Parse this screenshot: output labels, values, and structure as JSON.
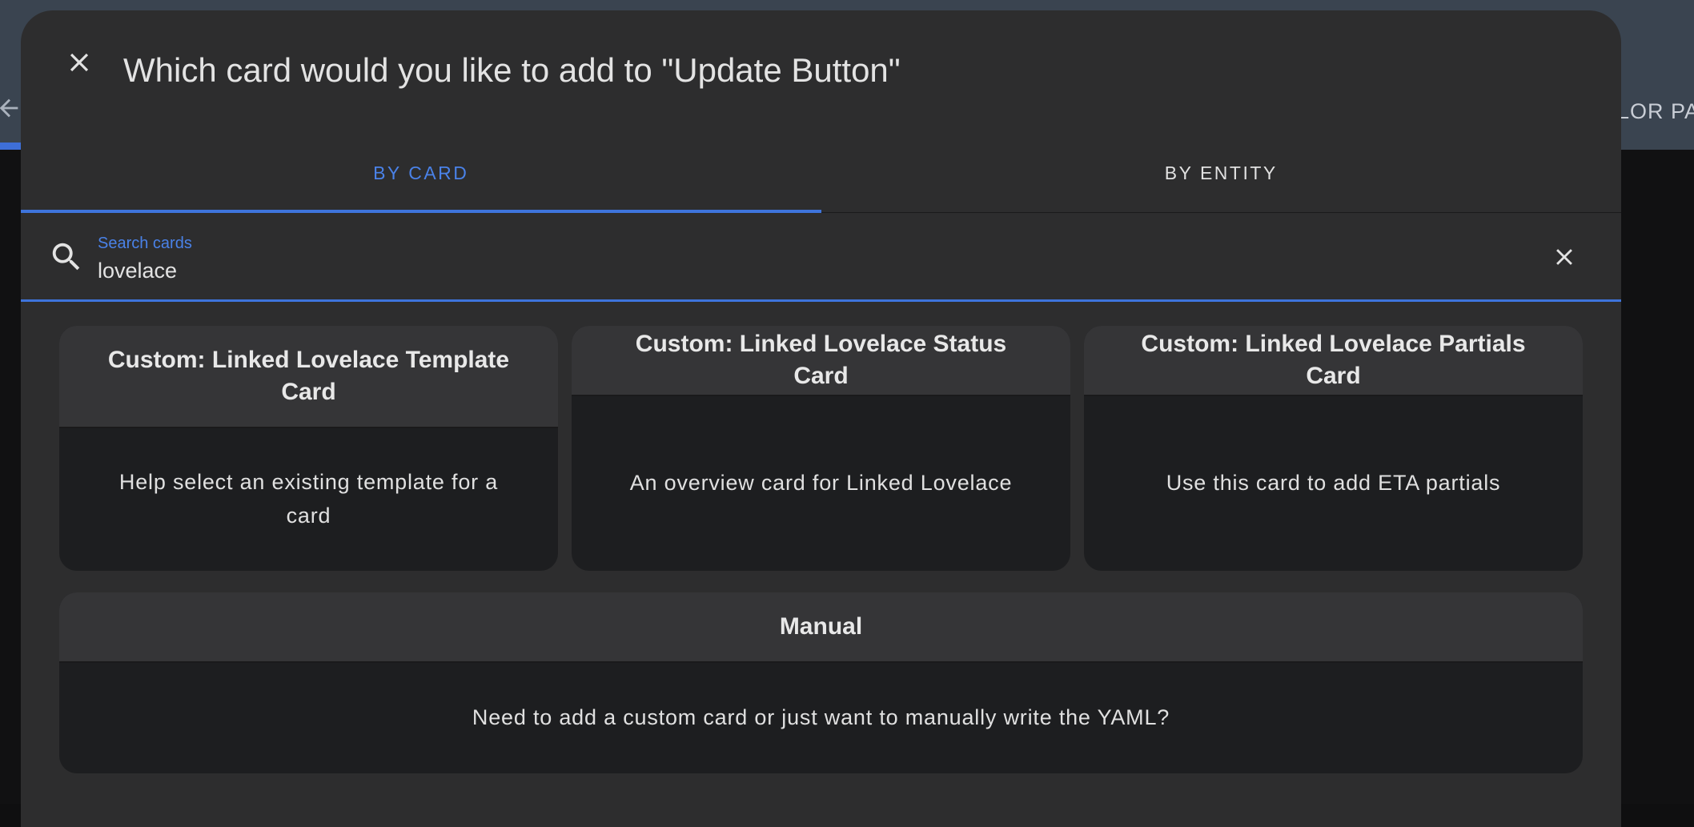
{
  "background": {
    "tab_fragment": "LOR PAI",
    "header_color": "#3a4450",
    "accent_color": "#3e74dc"
  },
  "dialog": {
    "title": "Which card would you like to add to \"Update Button\"",
    "close_icon": "close-icon",
    "tabs": [
      {
        "label": "BY CARD",
        "active": true
      },
      {
        "label": "BY ENTITY",
        "active": false
      }
    ]
  },
  "search": {
    "label": "Search cards",
    "value": "lovelace",
    "icon": "search-icon",
    "clear_icon": "clear-icon"
  },
  "cards": [
    {
      "title": "Custom: Linked Lovelace Template Card",
      "description": "Help select an existing template for a card"
    },
    {
      "title": "Custom: Linked Lovelace Status Card",
      "description": "An overview card for Linked Lovelace"
    },
    {
      "title": "Custom: Linked Lovelace Partials Card",
      "description": "Use this card to add ETA partials"
    }
  ],
  "manual_card": {
    "title": "Manual",
    "description": "Need to add a custom card or just want to manually write the YAML?"
  }
}
